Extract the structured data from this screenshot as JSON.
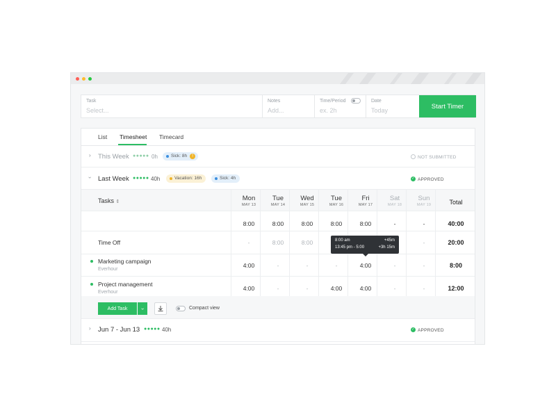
{
  "window": {
    "colors": {
      "close": "#ff5f57",
      "minimize": "#febc2e",
      "maximize": "#28c840"
    }
  },
  "form": {
    "task": {
      "label": "Task",
      "placeholder": "Select..."
    },
    "notes": {
      "label": "Notes",
      "placeholder": "Add..."
    },
    "time_period": {
      "label": "Time/Period",
      "placeholder": "ex. 2h"
    },
    "date": {
      "label": "Date",
      "placeholder": "Today"
    },
    "start_timer": "Start Timer"
  },
  "tabs": [
    {
      "label": "List",
      "active": false
    },
    {
      "label": "Timesheet",
      "active": true
    },
    {
      "label": "Timecard",
      "active": false
    }
  ],
  "this_week": {
    "title": "This Week",
    "hours": "0h",
    "badge": "Sick: 8h",
    "badge_icon": "warning-icon",
    "status": "NOT SUBMITTED"
  },
  "last_week": {
    "title": "Last Week",
    "hours": "40h",
    "badges": [
      "Vacation: 16h",
      "Sick: 4h"
    ],
    "status": "APPROVED"
  },
  "table": {
    "tasks_header": "Tasks",
    "total_header": "Total",
    "days": [
      {
        "name": "Mon",
        "date": "MAY 13",
        "muted": false
      },
      {
        "name": "Tue",
        "date": "MAY 14",
        "muted": false
      },
      {
        "name": "Wed",
        "date": "MAY 15",
        "muted": false
      },
      {
        "name": "Tue",
        "date": "MAY 16",
        "muted": false
      },
      {
        "name": "Fri",
        "date": "MAY 17",
        "muted": false
      },
      {
        "name": "Sat",
        "date": "MAY 18",
        "muted": true
      },
      {
        "name": "Sun",
        "date": "MAY 19",
        "muted": true
      }
    ],
    "summary_row": {
      "cells": [
        "8:00",
        "8:00",
        "8:00",
        "8:00",
        "8:00",
        "-",
        "-"
      ],
      "total": "40:00"
    },
    "rows": [
      {
        "name": "Time Off",
        "project": "",
        "has_dot": false,
        "cells": [
          "-",
          "8:00",
          "8:00",
          "",
          "",
          "",
          "-"
        ],
        "total": "20:00"
      },
      {
        "name": "Marketing campaign",
        "project": "Everhour",
        "has_dot": true,
        "cells": [
          "4:00",
          "-",
          "-",
          "-",
          "4:00",
          "-",
          "-"
        ],
        "total": "8:00"
      },
      {
        "name": "Project management",
        "project": "Everhour",
        "has_dot": true,
        "cells": [
          "4:00",
          "-",
          "-",
          "4:00",
          "4:00",
          "-",
          "-"
        ],
        "total": "12:00"
      }
    ],
    "tooltip": {
      "line1_left": "8:00 am",
      "line1_right": "+45m",
      "line2_left": "13:45 pm - 5:00",
      "line2_right": "+3h 15m"
    }
  },
  "footer": {
    "add_task": "Add Task",
    "compact_view": "Compact view"
  },
  "older_week": {
    "title": "Jun 7 - Jun 13",
    "hours": "40h",
    "status": "APPROVED"
  },
  "colors": {
    "accent": "#2dbd63",
    "approved": "#2dbd63",
    "sick_dot": "#3b8fe0",
    "vacation_dot": "#f0b429"
  }
}
